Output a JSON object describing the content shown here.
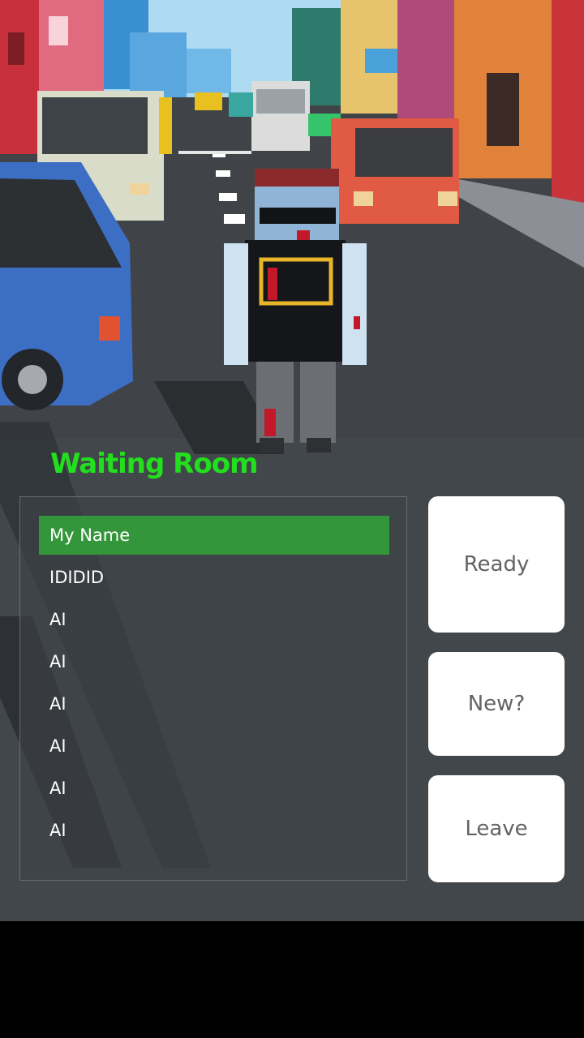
{
  "screen": {
    "title": "Waiting Room"
  },
  "players": [
    {
      "name": "My Name",
      "selected": true
    },
    {
      "name": "IDIDID",
      "selected": false
    },
    {
      "name": "AI",
      "selected": false
    },
    {
      "name": "AI",
      "selected": false
    },
    {
      "name": "AI",
      "selected": false
    },
    {
      "name": "AI",
      "selected": false
    },
    {
      "name": "AI",
      "selected": false
    },
    {
      "name": "AI",
      "selected": false
    }
  ],
  "actions": {
    "ready": "Ready",
    "new": "New?",
    "leave": "Leave"
  },
  "colors": {
    "title": "#22e01e",
    "selected_row": "#34963a",
    "button_bg": "#ffffff",
    "button_text": "#636363"
  }
}
